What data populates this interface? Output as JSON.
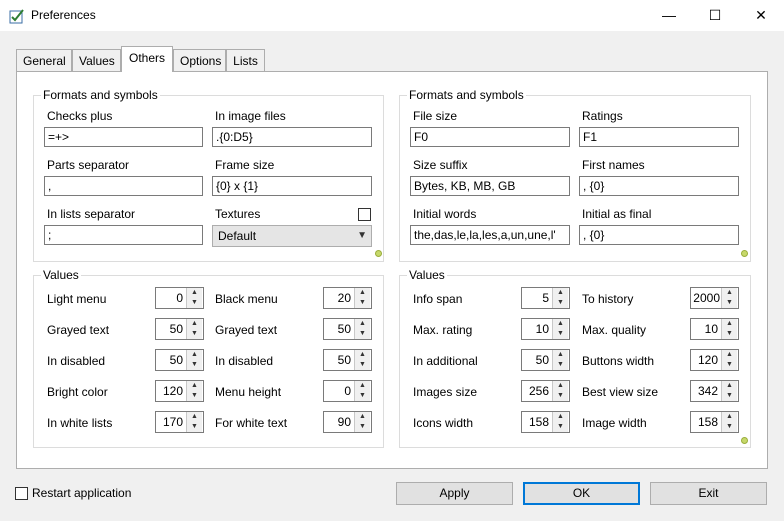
{
  "window": {
    "title": "Preferences",
    "minimize": "—",
    "maximize": "☐",
    "close": "✕"
  },
  "tabs": [
    {
      "label": "General"
    },
    {
      "label": "Values"
    },
    {
      "label": "Others",
      "active": true
    },
    {
      "label": "Options"
    },
    {
      "label": "Lists"
    }
  ],
  "left_formats": {
    "title": "Formats and symbols",
    "checks_plus": {
      "label": "Checks plus",
      "value": "=+>"
    },
    "in_image_files": {
      "label": "In image files",
      "value": ".{0:D5}"
    },
    "parts_separator": {
      "label": "Parts separator",
      "value": ","
    },
    "frame_size": {
      "label": "Frame size",
      "value": "{0} x {1}"
    },
    "in_lists_separator": {
      "label": "In lists separator",
      "value": ";"
    },
    "textures": {
      "label": "Textures",
      "value": "Default",
      "checked": false
    }
  },
  "right_formats": {
    "title": "Formats and symbols",
    "file_size": {
      "label": "File size",
      "value": "F0"
    },
    "ratings": {
      "label": "Ratings",
      "value": "F1"
    },
    "size_suffix": {
      "label": "Size suffix",
      "value": "Bytes, KB, MB, GB"
    },
    "first_names": {
      "label": "First names",
      "value": ", {0}"
    },
    "initial_words": {
      "label": "Initial words",
      "value": "the,das,le,la,les,a,un,une,l'"
    },
    "initial_as_final": {
      "label": "Initial as final",
      "value": ", {0}"
    }
  },
  "left_values": {
    "title": "Values",
    "rows": [
      {
        "l_label": "Light menu",
        "l_value": "0",
        "r_label": "Black menu",
        "r_value": "20"
      },
      {
        "l_label": "Grayed text",
        "l_value": "50",
        "r_label": "Grayed text",
        "r_value": "50"
      },
      {
        "l_label": "In disabled",
        "l_value": "50",
        "r_label": "In disabled",
        "r_value": "50"
      },
      {
        "l_label": "Bright color",
        "l_value": "120",
        "r_label": "Menu height",
        "r_value": "0"
      },
      {
        "l_label": "In white lists",
        "l_value": "170",
        "r_label": "For white text",
        "r_value": "90"
      }
    ]
  },
  "right_values": {
    "title": "Values",
    "rows": [
      {
        "l_label": "Info span",
        "l_value": "5",
        "r_label": "To history",
        "r_value": "2000"
      },
      {
        "l_label": "Max. rating",
        "l_value": "10",
        "r_label": "Max. quality",
        "r_value": "10"
      },
      {
        "l_label": "In additional",
        "l_value": "50",
        "r_label": "Buttons width",
        "r_value": "120"
      },
      {
        "l_label": "Images size",
        "l_value": "256",
        "r_label": "Best view size",
        "r_value": "342"
      },
      {
        "l_label": "Icons width",
        "l_value": "158",
        "r_label": "Image width",
        "r_value": "158"
      }
    ]
  },
  "footer": {
    "restart_label": "Restart application",
    "restart_checked": false,
    "apply": "Apply",
    "ok": "OK",
    "exit": "Exit"
  },
  "colors": {
    "accent": "#0078d7",
    "grip": "#c6d86a"
  }
}
